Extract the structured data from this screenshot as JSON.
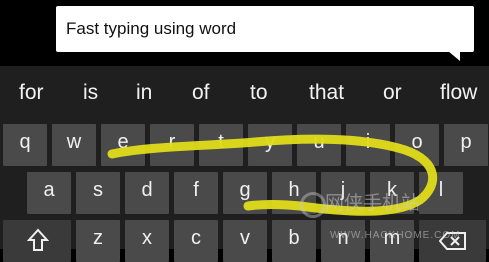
{
  "input_preview": {
    "text": "Fast typing using word"
  },
  "suggestions": [
    "for",
    "is",
    "in",
    "of",
    "to",
    "that",
    "or",
    "flow"
  ],
  "keyboard": {
    "row1": [
      "q",
      "w",
      "e",
      "r",
      "t",
      "y",
      "u",
      "i",
      "o",
      "p"
    ],
    "row2": [
      "a",
      "s",
      "d",
      "f",
      "g",
      "h",
      "j",
      "k",
      "l"
    ],
    "row3": [
      "z",
      "x",
      "c",
      "v",
      "b",
      "n",
      "m"
    ],
    "shift_icon": "shift-arrow-icon",
    "backspace_icon": "backspace-icon"
  },
  "swipe_trail": {
    "color": "#e0dc1a"
  },
  "watermark": {
    "text": "网侠手机站",
    "url": "WWW.HACKHOME.COM"
  }
}
